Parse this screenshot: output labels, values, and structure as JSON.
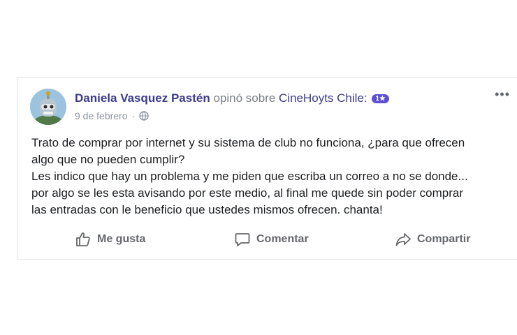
{
  "post": {
    "author": "Daniela Vasquez Pastén",
    "verb": "opinó sobre",
    "page": "CineHoyts Chile:",
    "badge": "1★",
    "date": "9 de febrero",
    "separator": "·",
    "more": "•••",
    "body_lines": [
      "Trato de comprar por internet y su sistema de club no funciona, ¿para que ofrecen",
      "algo que no pueden cumplir?",
      "Les indico que hay un problema y me piden que escriba un correo a no se donde...",
      "por algo se les esta avisando por este medio, al final me quede sin poder comprar",
      "las entradas con le beneficio que ustedes mismos ofrecen. chanta!"
    ]
  },
  "actions": {
    "like": "Me gusta",
    "comment": "Comentar",
    "share": "Compartir"
  },
  "icons": {
    "avatar": "robot-character-avatar",
    "privacy": "globe-icon",
    "like": "thumbs-up-icon",
    "comment": "speech-bubble-icon",
    "share": "share-arrow-icon",
    "more": "ellipsis-icon"
  },
  "colors": {
    "name": "#3b3a8f",
    "badge": "#5b4fd6",
    "body_text": "#1c1e21",
    "muted": "#65676b"
  }
}
